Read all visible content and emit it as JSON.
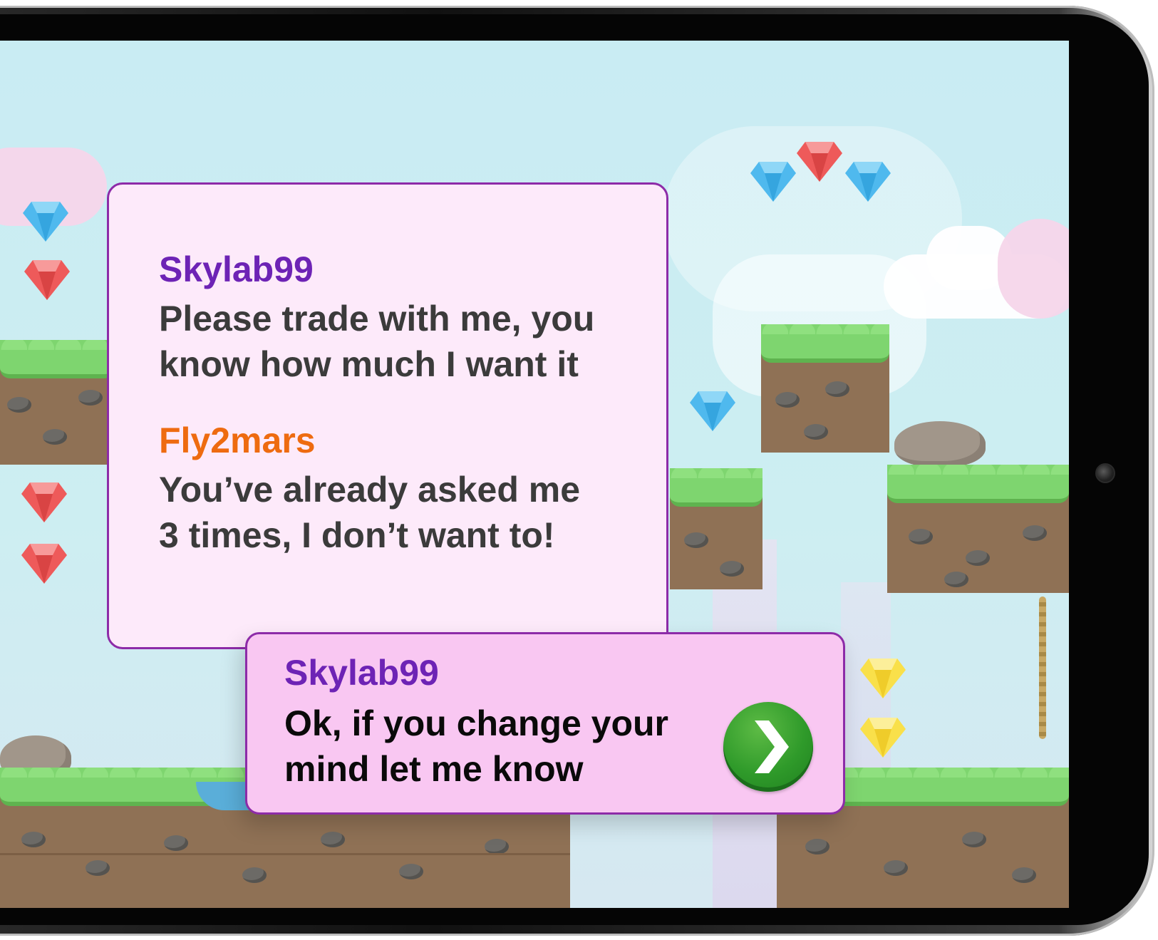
{
  "dialog": {
    "messages": [
      {
        "speaker": "Skylab99",
        "text_line1": "Please trade with me, you",
        "text_line2": "know how much I want it",
        "speaker_color": "#6d23b5"
      },
      {
        "speaker": "Fly2mars",
        "text_line1": "You’ve already asked me",
        "text_line2": "3 times, I don’t want to!",
        "speaker_color": "#ee6b10"
      }
    ],
    "reply": {
      "speaker": "Skylab99",
      "text_line1": "Ok, if you change your",
      "text_line2": "mind let me know",
      "speaker_color": "#6d23b5"
    },
    "next_button_icon": "chevron-right-icon"
  },
  "scene": {
    "gems": {
      "blue": "#4fb9ee",
      "red": "#ee5a5a",
      "yellow": "#f9e04a"
    }
  },
  "colors": {
    "panel_border": "#8d2ba8",
    "panel_bg": "#fdeafa",
    "reply_bg": "#f9c7f2",
    "next_button": "#2f9a2a"
  }
}
